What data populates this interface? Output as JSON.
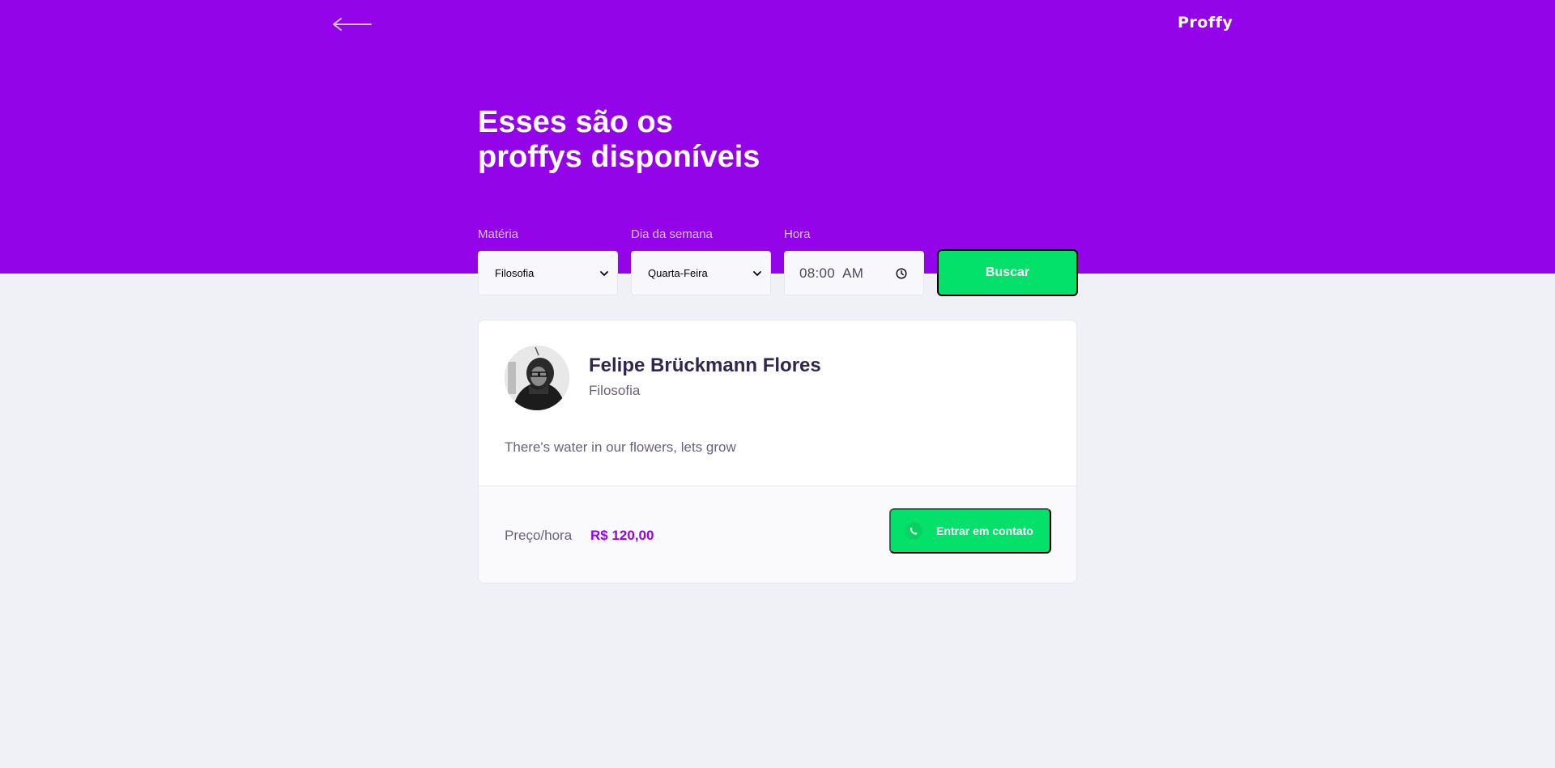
{
  "app": {
    "logo": "Proffy"
  },
  "header": {
    "title_line1": "Esses são os",
    "title_line2": "proffys disponíveis"
  },
  "filters": {
    "subject_label": "Matéria",
    "subject_value": "Filosofia",
    "weekday_label": "Dia da semana",
    "weekday_value": "Quarta-Feira",
    "time_label": "Hora",
    "time_value": "08:00  AM",
    "search_button": "Buscar"
  },
  "teacher": {
    "name": "Felipe Brückmann Flores",
    "subject": "Filosofia",
    "bio": "There's water in our flowers, lets grow",
    "price_label": "Preço/hora",
    "price_value": "R$ 120,00",
    "contact_button": "Entrar em contato"
  },
  "colors": {
    "primary": "#9404e8",
    "background": "#f0f0f7",
    "secondary": "#04e16a",
    "title_text": "#32264d",
    "body_text": "#6a6180"
  },
  "icons": {
    "back": "arrow-left-icon",
    "dropdown": "chevron-down-icon",
    "clock": "clock-icon",
    "whatsapp": "whatsapp-icon"
  }
}
